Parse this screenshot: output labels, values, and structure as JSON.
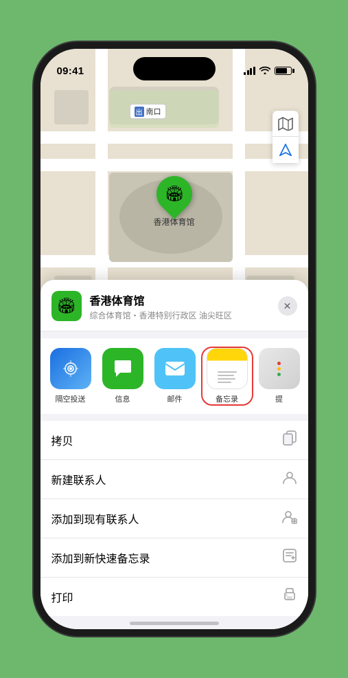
{
  "status_bar": {
    "time": "09:41",
    "location_arrow": "▶"
  },
  "map": {
    "label": "南口",
    "label_prefix": "出"
  },
  "location_pin": {
    "emoji": "🏟",
    "name": "香港体育馆"
  },
  "map_controls": {
    "map_icon": "🗺",
    "nav_icon": "➤"
  },
  "location_header": {
    "icon_emoji": "🏟",
    "name": "香港体育馆",
    "subtitle": "综合体育馆・香港特别行政区 油尖旺区",
    "close_label": "✕"
  },
  "share_row": {
    "items": [
      {
        "id": "airdrop",
        "label": "隔空投送",
        "emoji": "📡"
      },
      {
        "id": "messages",
        "label": "信息",
        "emoji": "💬"
      },
      {
        "id": "mail",
        "label": "邮件",
        "emoji": "✉️"
      },
      {
        "id": "notes",
        "label": "备忘录",
        "emoji": ""
      },
      {
        "id": "more",
        "label": "提",
        "emoji": ""
      }
    ]
  },
  "action_list": {
    "items": [
      {
        "id": "copy",
        "label": "拷贝",
        "icon": "copy"
      },
      {
        "id": "new-contact",
        "label": "新建联系人",
        "icon": "person"
      },
      {
        "id": "add-existing",
        "label": "添加到现有联系人",
        "icon": "person-add"
      },
      {
        "id": "add-note",
        "label": "添加到新快速备忘录",
        "icon": "note"
      },
      {
        "id": "print",
        "label": "打印",
        "icon": "printer"
      }
    ]
  }
}
